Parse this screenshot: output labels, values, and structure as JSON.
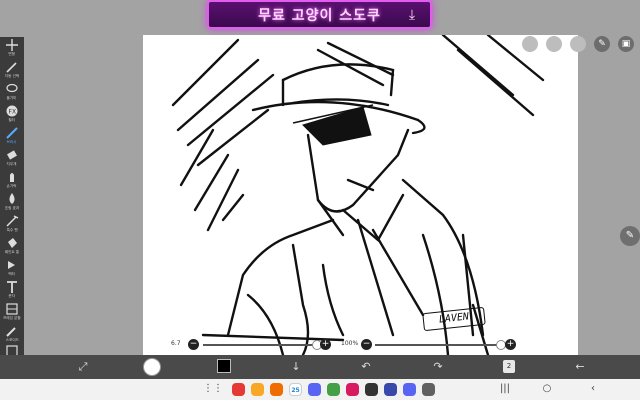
{
  "ad": {
    "text": "무료 고양이 스도쿠",
    "icon": "download-icon"
  },
  "left_toolbar": {
    "tools": [
      {
        "name": "move",
        "label": "변형",
        "icon": "move-icon"
      },
      {
        "name": "select",
        "label": "자동 선택",
        "icon": "magic-wand-icon"
      },
      {
        "name": "lasso",
        "label": "올가미",
        "icon": "lasso-icon"
      },
      {
        "name": "filter",
        "label": "필터",
        "icon": "fx-icon"
      },
      {
        "name": "brush",
        "label": "브러시",
        "icon": "brush-icon",
        "active": true
      },
      {
        "name": "eraser",
        "label": "지우개",
        "icon": "eraser-icon"
      },
      {
        "name": "smudge",
        "label": "손가락",
        "icon": "finger-icon"
      },
      {
        "name": "blur",
        "label": "흐림 효과",
        "icon": "drop-icon"
      },
      {
        "name": "special",
        "label": "특수 펜",
        "icon": "special-pen-icon"
      },
      {
        "name": "fill",
        "label": "페인트 통",
        "icon": "bucket-icon"
      },
      {
        "name": "vector",
        "label": "벡터",
        "icon": "vector-icon"
      },
      {
        "name": "text",
        "label": "문자",
        "icon": "text-icon"
      },
      {
        "name": "frame",
        "label": "프레임 분할",
        "icon": "frame-icon"
      },
      {
        "name": "dropper",
        "label": "스포이드",
        "icon": "eyedropper-icon"
      },
      {
        "name": "canvas",
        "label": "캔버스",
        "icon": "canvas-icon"
      }
    ]
  },
  "canvas": {
    "signature": "LAVEN"
  },
  "slider": {
    "size_label": "6.7",
    "opacity_label": "100%",
    "size_value": 0.95,
    "opacity_value": 0.97
  },
  "bottom_bar": {
    "layer_count": "2"
  },
  "nav": {
    "apps": [
      {
        "name": "app-red",
        "color": "#e53935",
        "label": ""
      },
      {
        "name": "app-yellow",
        "color": "#f9a825",
        "label": ""
      },
      {
        "name": "app-orange",
        "color": "#ef6c00",
        "label": ""
      },
      {
        "name": "calendar",
        "color": "#1e88e5",
        "label": "25"
      },
      {
        "name": "app-discord",
        "color": "#5865f2",
        "label": ""
      },
      {
        "name": "app-green",
        "color": "#43a047",
        "label": ""
      },
      {
        "name": "app-magenta",
        "color": "#d81b60",
        "label": ""
      },
      {
        "name": "app-dark",
        "color": "#333333",
        "label": ""
      },
      {
        "name": "app-indigo",
        "color": "#3949ab",
        "label": ""
      },
      {
        "name": "app-discord2",
        "color": "#5865f2",
        "label": ""
      },
      {
        "name": "app-gray",
        "color": "#616161",
        "label": ""
      }
    ]
  }
}
